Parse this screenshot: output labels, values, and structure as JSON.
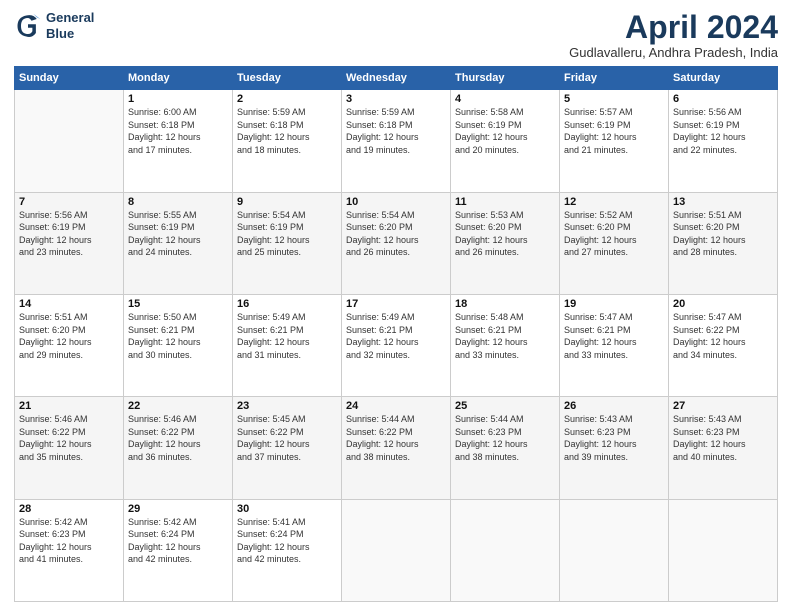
{
  "logo": {
    "line1": "General",
    "line2": "Blue"
  },
  "title": "April 2024",
  "location": "Gudlavalleru, Andhra Pradesh, India",
  "days_header": [
    "Sunday",
    "Monday",
    "Tuesday",
    "Wednesday",
    "Thursday",
    "Friday",
    "Saturday"
  ],
  "weeks": [
    [
      {
        "day": "",
        "text": ""
      },
      {
        "day": "1",
        "text": "Sunrise: 6:00 AM\nSunset: 6:18 PM\nDaylight: 12 hours\nand 17 minutes."
      },
      {
        "day": "2",
        "text": "Sunrise: 5:59 AM\nSunset: 6:18 PM\nDaylight: 12 hours\nand 18 minutes."
      },
      {
        "day": "3",
        "text": "Sunrise: 5:59 AM\nSunset: 6:18 PM\nDaylight: 12 hours\nand 19 minutes."
      },
      {
        "day": "4",
        "text": "Sunrise: 5:58 AM\nSunset: 6:19 PM\nDaylight: 12 hours\nand 20 minutes."
      },
      {
        "day": "5",
        "text": "Sunrise: 5:57 AM\nSunset: 6:19 PM\nDaylight: 12 hours\nand 21 minutes."
      },
      {
        "day": "6",
        "text": "Sunrise: 5:56 AM\nSunset: 6:19 PM\nDaylight: 12 hours\nand 22 minutes."
      }
    ],
    [
      {
        "day": "7",
        "text": "Sunrise: 5:56 AM\nSunset: 6:19 PM\nDaylight: 12 hours\nand 23 minutes."
      },
      {
        "day": "8",
        "text": "Sunrise: 5:55 AM\nSunset: 6:19 PM\nDaylight: 12 hours\nand 24 minutes."
      },
      {
        "day": "9",
        "text": "Sunrise: 5:54 AM\nSunset: 6:19 PM\nDaylight: 12 hours\nand 25 minutes."
      },
      {
        "day": "10",
        "text": "Sunrise: 5:54 AM\nSunset: 6:20 PM\nDaylight: 12 hours\nand 26 minutes."
      },
      {
        "day": "11",
        "text": "Sunrise: 5:53 AM\nSunset: 6:20 PM\nDaylight: 12 hours\nand 26 minutes."
      },
      {
        "day": "12",
        "text": "Sunrise: 5:52 AM\nSunset: 6:20 PM\nDaylight: 12 hours\nand 27 minutes."
      },
      {
        "day": "13",
        "text": "Sunrise: 5:51 AM\nSunset: 6:20 PM\nDaylight: 12 hours\nand 28 minutes."
      }
    ],
    [
      {
        "day": "14",
        "text": "Sunrise: 5:51 AM\nSunset: 6:20 PM\nDaylight: 12 hours\nand 29 minutes."
      },
      {
        "day": "15",
        "text": "Sunrise: 5:50 AM\nSunset: 6:21 PM\nDaylight: 12 hours\nand 30 minutes."
      },
      {
        "day": "16",
        "text": "Sunrise: 5:49 AM\nSunset: 6:21 PM\nDaylight: 12 hours\nand 31 minutes."
      },
      {
        "day": "17",
        "text": "Sunrise: 5:49 AM\nSunset: 6:21 PM\nDaylight: 12 hours\nand 32 minutes."
      },
      {
        "day": "18",
        "text": "Sunrise: 5:48 AM\nSunset: 6:21 PM\nDaylight: 12 hours\nand 33 minutes."
      },
      {
        "day": "19",
        "text": "Sunrise: 5:47 AM\nSunset: 6:21 PM\nDaylight: 12 hours\nand 33 minutes."
      },
      {
        "day": "20",
        "text": "Sunrise: 5:47 AM\nSunset: 6:22 PM\nDaylight: 12 hours\nand 34 minutes."
      }
    ],
    [
      {
        "day": "21",
        "text": "Sunrise: 5:46 AM\nSunset: 6:22 PM\nDaylight: 12 hours\nand 35 minutes."
      },
      {
        "day": "22",
        "text": "Sunrise: 5:46 AM\nSunset: 6:22 PM\nDaylight: 12 hours\nand 36 minutes."
      },
      {
        "day": "23",
        "text": "Sunrise: 5:45 AM\nSunset: 6:22 PM\nDaylight: 12 hours\nand 37 minutes."
      },
      {
        "day": "24",
        "text": "Sunrise: 5:44 AM\nSunset: 6:22 PM\nDaylight: 12 hours\nand 38 minutes."
      },
      {
        "day": "25",
        "text": "Sunrise: 5:44 AM\nSunset: 6:23 PM\nDaylight: 12 hours\nand 38 minutes."
      },
      {
        "day": "26",
        "text": "Sunrise: 5:43 AM\nSunset: 6:23 PM\nDaylight: 12 hours\nand 39 minutes."
      },
      {
        "day": "27",
        "text": "Sunrise: 5:43 AM\nSunset: 6:23 PM\nDaylight: 12 hours\nand 40 minutes."
      }
    ],
    [
      {
        "day": "28",
        "text": "Sunrise: 5:42 AM\nSunset: 6:23 PM\nDaylight: 12 hours\nand 41 minutes."
      },
      {
        "day": "29",
        "text": "Sunrise: 5:42 AM\nSunset: 6:24 PM\nDaylight: 12 hours\nand 42 minutes."
      },
      {
        "day": "30",
        "text": "Sunrise: 5:41 AM\nSunset: 6:24 PM\nDaylight: 12 hours\nand 42 minutes."
      },
      {
        "day": "",
        "text": ""
      },
      {
        "day": "",
        "text": ""
      },
      {
        "day": "",
        "text": ""
      },
      {
        "day": "",
        "text": ""
      }
    ]
  ]
}
